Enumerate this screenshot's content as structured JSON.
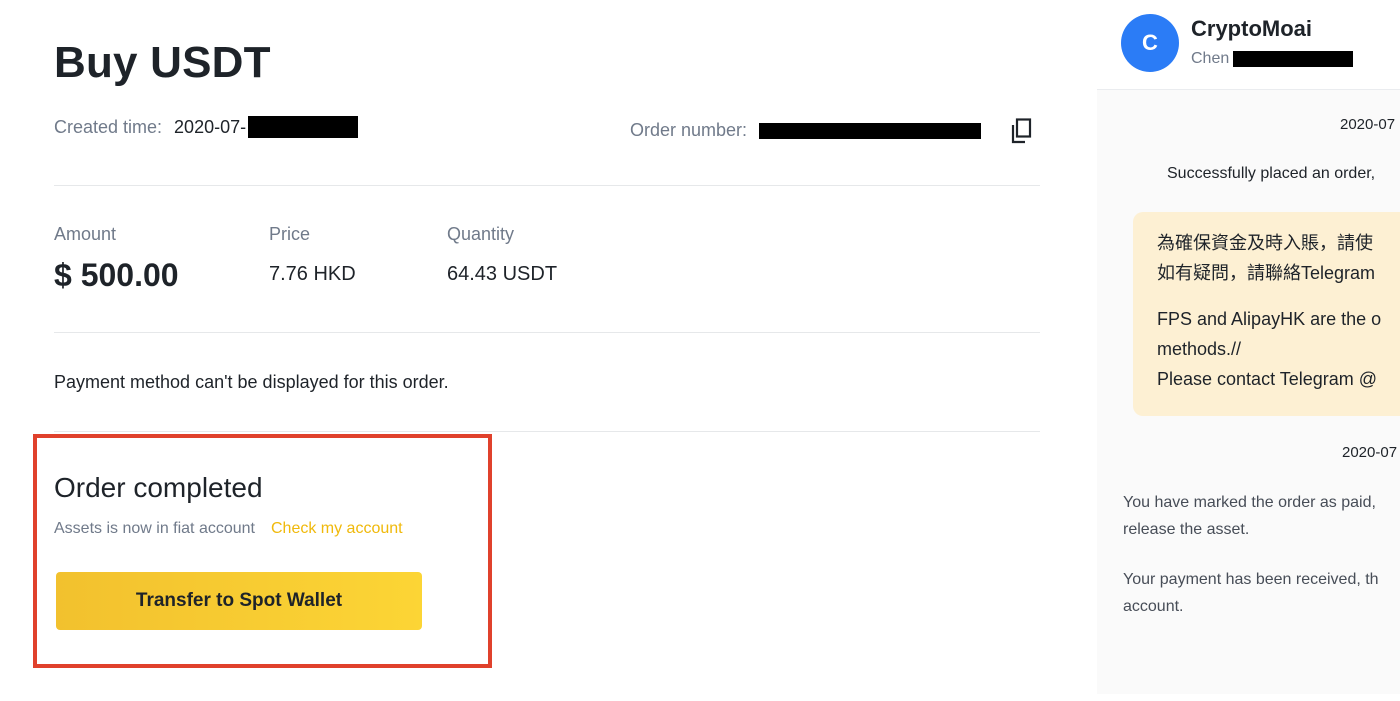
{
  "order": {
    "title": "Buy USDT",
    "created_label": "Created time:",
    "created_value": "2020-07-",
    "order_number_label": "Order number:",
    "amount_label": "Amount",
    "amount_value": "$ 500.00",
    "price_label": "Price",
    "price_value": "7.76 HKD",
    "quantity_label": "Quantity",
    "quantity_value": "64.43 USDT",
    "payment_note": "Payment method can't be displayed for this order.",
    "status_title": "Order completed",
    "assets_note": "Assets is now in fiat account",
    "check_link": "Check my account",
    "transfer_button": "Transfer to Spot Wallet"
  },
  "chat": {
    "avatar_letter": "C",
    "name": "CryptoMoai",
    "sub": "Chen",
    "date1": "2020-07",
    "system_msg1": "Successfully placed an order,",
    "bubble_line1": "為確保資金及時入賬，請使",
    "bubble_line2": "如有疑問，請聯絡Telegram",
    "bubble_line3": "FPS and AlipayHK are the o",
    "bubble_line4": "methods.//",
    "bubble_line5": "Please contact Telegram @",
    "date2": "2020-07",
    "msg_paid_line1": "You have marked the order as paid,",
    "msg_paid_line2": "release the asset.",
    "msg_received_line1": "Your payment has been received, th",
    "msg_received_line2": "account."
  },
  "colors": {
    "accent_yellow": "#f0b90b",
    "highlight_red": "#e0412c",
    "avatar_blue": "#2b7cf6",
    "bubble_bg": "#fdf0d3"
  },
  "icons": {
    "copy": "copy-icon"
  }
}
